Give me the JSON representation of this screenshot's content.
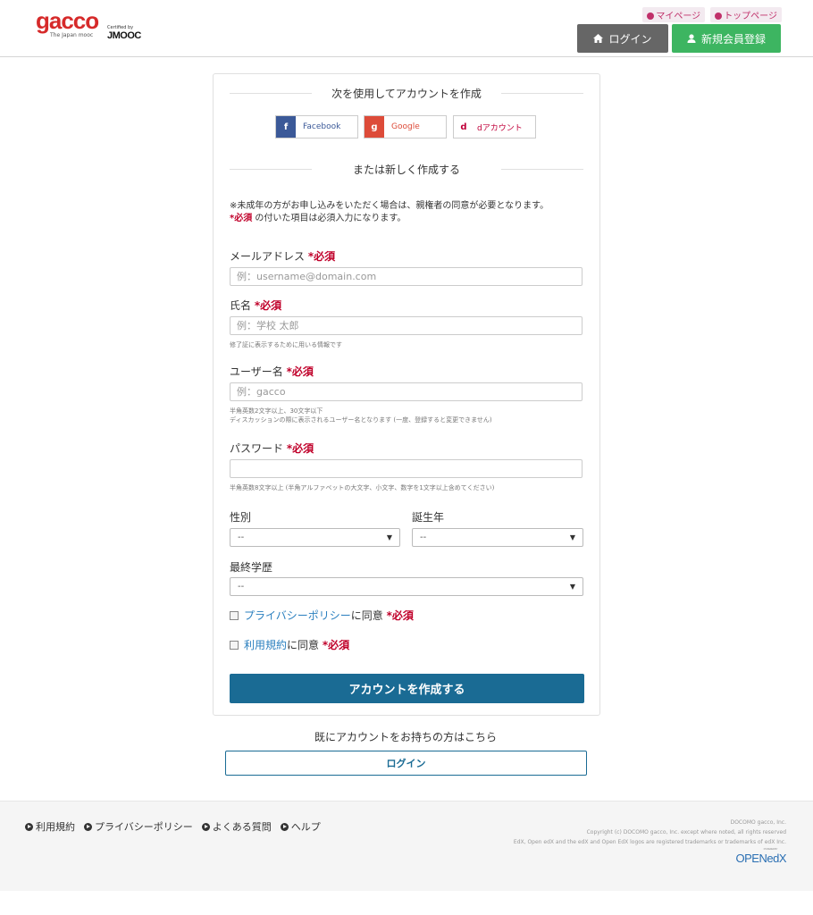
{
  "header": {
    "logo_text": "gacco",
    "logo_sub": "The Japan mooc",
    "certified_by": "Certified by",
    "jmooc": "JMOOC",
    "mypage": "マイページ",
    "toppage": "トップページ",
    "login_button": "ログイン",
    "register_button": "新規会員登録",
    "login_icon": "home-icon",
    "register_icon": "user-icon"
  },
  "form": {
    "social_title": "次を使用してアカウントを作成",
    "social": [
      {
        "icon": "f",
        "label": "Facebook"
      },
      {
        "icon": "g",
        "label": "Google"
      },
      {
        "icon": "d",
        "label": "dアカウント"
      }
    ],
    "new_title": "または新しく作成する",
    "note_line1": "※未成年の方がお申し込みをいただく場合は、親権者の同意が必要となります。",
    "note_req": "*必須",
    "note_line2": " の付いた項目は必須入力になります。",
    "required_mark": "*必須",
    "email_label": "メールアドレス ",
    "email_placeholder": "例：username@domain.com",
    "name_label": "氏名 ",
    "name_placeholder": "例：学校 太郎",
    "name_help": "修了証に表示するために用いる情報です",
    "username_label": "ユーザー名 ",
    "username_placeholder": "例：gacco",
    "username_help1": "半角英数2文字以上、30文字以下",
    "username_help2": "ディスカッションの際に表示されるユーザー名となります (一度、登録すると変更できません)",
    "password_label": "パスワード ",
    "password_help": "半角英数8文字以上 (半角アルファベットの大文字、小文字、数字を1文字以上含めてください)",
    "gender_label": "性別",
    "gender_value": "--",
    "birth_label": "誕生年",
    "birth_value": "--",
    "education_label": "最終学歴",
    "education_value": "--",
    "privacy_link": "プライバシーポリシー",
    "agree_text": "に同意 ",
    "terms_link": "利用規約",
    "submit": "アカウントを作成する"
  },
  "existing": {
    "text": "既にアカウントをお持ちの方はこちら",
    "login": "ログイン"
  },
  "footer": {
    "links": [
      "利用規約",
      "プライバシーポリシー",
      "よくある質問",
      "ヘルプ"
    ],
    "company": "DOCOMO gacco, Inc.",
    "copyright": "Copyright (c) DOCOMO gacco, Inc. except where noted, all rights reserved",
    "trademark": "EdX, Open edX and the edX and Open EdX logos are registered trademarks or trademarks of edX Inc.",
    "powered_by": "POWERED BY",
    "openedx": "OPENedX"
  }
}
